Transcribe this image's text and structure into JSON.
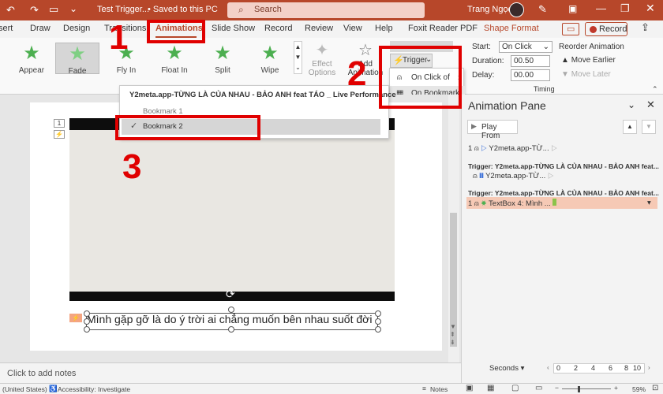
{
  "titlebar": {
    "doc_title": "Test Trigger...",
    "saved_status": "• Saved to this PC",
    "search_placeholder": "Search",
    "user_name": "Trang Ngọc"
  },
  "tabs": [
    "sert",
    "Draw",
    "Design",
    "Transitions",
    "Animations",
    "Slide Show",
    "Record",
    "Review",
    "View",
    "Help",
    "Foxit Reader PDF",
    "Shape Format"
  ],
  "record_label": "Record",
  "ribbon": {
    "effects": [
      "Appear",
      "Fade",
      "Fly In",
      "Float In",
      "Split",
      "Wipe"
    ],
    "effect_options": [
      "Effect",
      "Options"
    ],
    "add_animation": [
      "Add",
      "Animation"
    ],
    "trigger": "Trigger",
    "trigger_menu": [
      "On Click of",
      "On Bookmark"
    ],
    "start_label": "Start:",
    "start_value": "On Click",
    "duration_label": "Duration:",
    "duration_value": "00.50",
    "delay_label": "Delay:",
    "delay_value": "00.00",
    "reorder_label": "Reorder Animation",
    "move_earlier": "Move Earlier",
    "move_later": "Move Later",
    "timing_group": "Timing"
  },
  "bookmark_menu": {
    "header": "Y2meta.app-TỪNG LÀ CỦA NHAU - BẢO ANH feat TÁO _ Live Performance",
    "items": [
      "Bookmark 1",
      "Bookmark 2"
    ]
  },
  "slide": {
    "caption": "Mình gặp gỡ là do ý trời ai chẳng muốn bên nhau suốt đời",
    "tags": [
      "1",
      "⚡",
      "⚡"
    ]
  },
  "notes_placeholder": "Click to add notes",
  "pane": {
    "title": "Animation Pane",
    "play_from": "Play From",
    "item1_num": "1",
    "item1_label": "Y2meta.app-TỪ...",
    "trigger1": "Trigger: Y2meta.app-TỪNG LÀ CỦA NHAU - BẢO ANH feat...",
    "trigger_item_label": "Y2meta.app-TỪ...",
    "trigger2": "Trigger: Y2meta.app-TỪNG LÀ CỦA NHAU - BẢO ANH feat...",
    "item3_num": "1",
    "item3_label": "TextBox 4: Mình ...",
    "seconds_label": "Seconds",
    "timeline": [
      "0",
      "2",
      "4",
      "6",
      "8",
      "10"
    ]
  },
  "status": {
    "language": "(United States)",
    "accessibility": "Accessibility: Investigate",
    "notes": "Notes",
    "zoom": "59%"
  },
  "annotations": [
    "1",
    "2",
    "3"
  ],
  "colors": {
    "accent": "#b7472a",
    "annotation": "#e00000",
    "effect_star": "#4caf50"
  }
}
